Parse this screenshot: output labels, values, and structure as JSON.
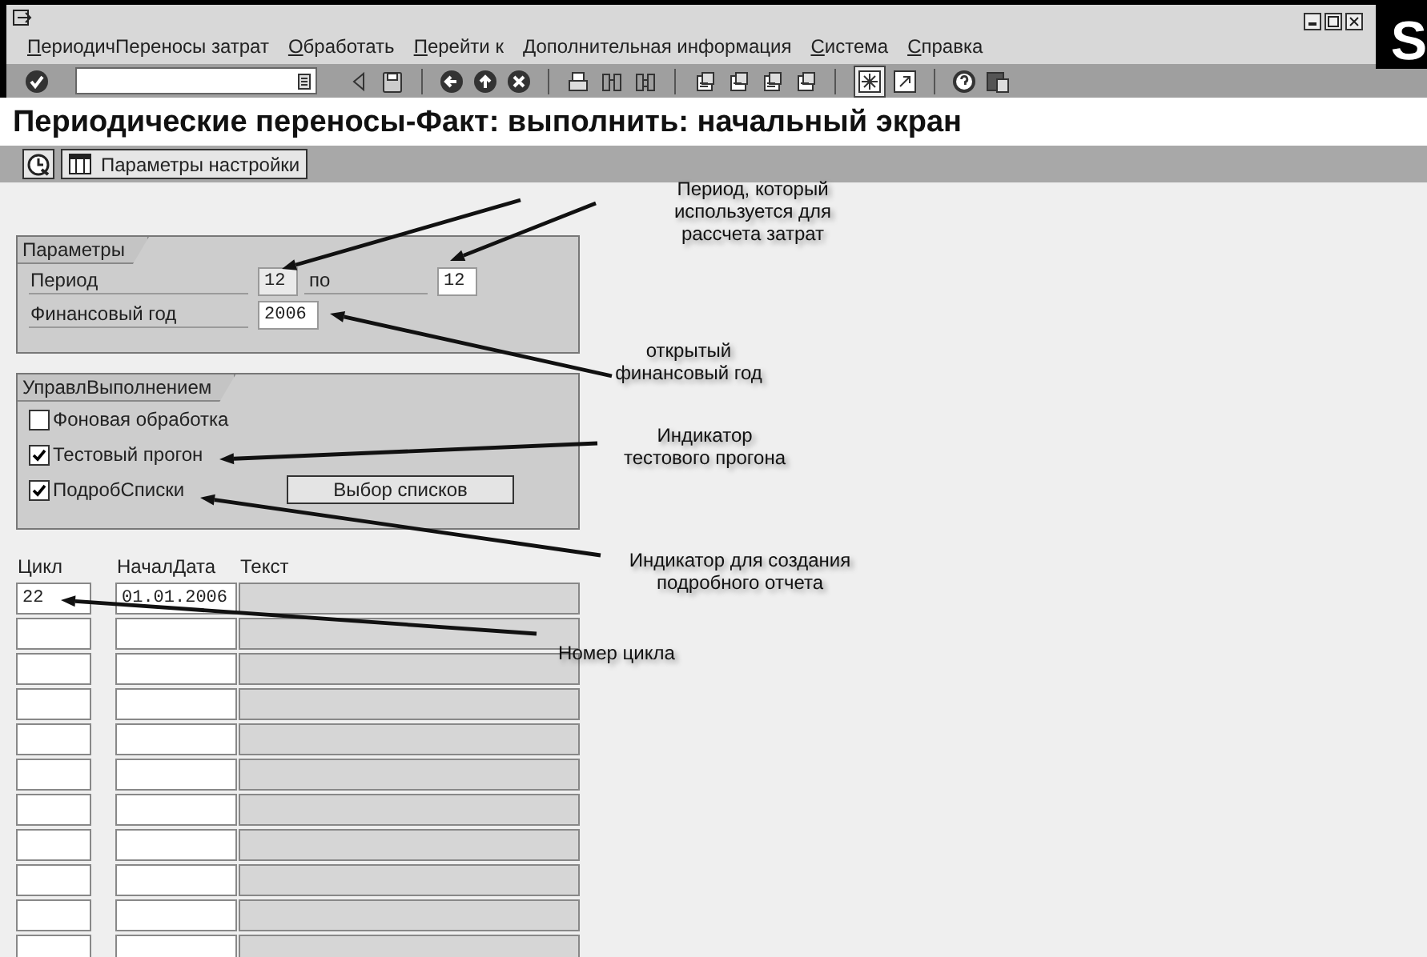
{
  "window": {
    "menu": [
      "ПериодичПереносы затрат",
      "Обработать",
      "Перейти к",
      "Дополнительная информация",
      "Система",
      "Справка"
    ],
    "logo_text": "S"
  },
  "title": "Периодические переносы-Факт: выполнить: начальный экран",
  "app_toolbar": [
    {
      "kind": "icon"
    },
    {
      "kind": "labeled",
      "label": "Параметры настройки"
    }
  ],
  "parameters": {
    "title": "Параметры",
    "period": {
      "label": "Период",
      "from": "12",
      "to_label": "по",
      "to": "12"
    },
    "fiscal_year": {
      "label": "Финансовый год",
      "value": "2006"
    }
  },
  "execution_control": {
    "title": "УправлВыполнением",
    "options": [
      {
        "label": "Фоновая обработка",
        "checked": false
      },
      {
        "label": "Тестовый прогон",
        "checked": true
      },
      {
        "label": "ПодробСписки",
        "checked": true
      }
    ],
    "button": "Выбор списков"
  },
  "table": {
    "columns": [
      "Цикл",
      "НачалДата",
      "Текст"
    ],
    "rows": [
      {
        "cycle": "22",
        "start_date": "01.01.2006"
      }
    ]
  },
  "annotations": [
    {
      "text": "Период, который\nиспользуется для\nрассчета затрат"
    },
    {
      "text": "открытый\nфинансовый год"
    },
    {
      "text": "Индикатор\nтестового прогона"
    },
    {
      "text": "Индикатор для создания\nподробного отчета"
    },
    {
      "text": "Номер цикла"
    }
  ]
}
